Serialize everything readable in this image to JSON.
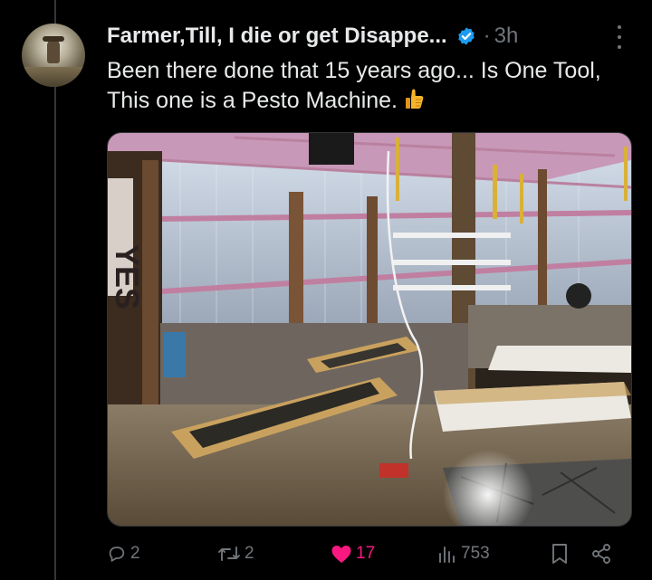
{
  "tweet": {
    "author_name": "Farmer,Till, I die or get Disappe...",
    "separator": "·",
    "time": "3h",
    "text": "Been there done that 15 years ago... Is One Tool, This one is a Pesto Machine.",
    "emoji_name": "thumbs-up-icon",
    "media_sign_text": "YES"
  },
  "actions": {
    "reply_count": "2",
    "repost_count": "2",
    "like_count": "17",
    "view_count": "753"
  },
  "colors": {
    "background": "#000000",
    "text": "#e7e9ea",
    "muted": "#71767b",
    "verified": "#1d9bf0",
    "like": "#f91880"
  }
}
